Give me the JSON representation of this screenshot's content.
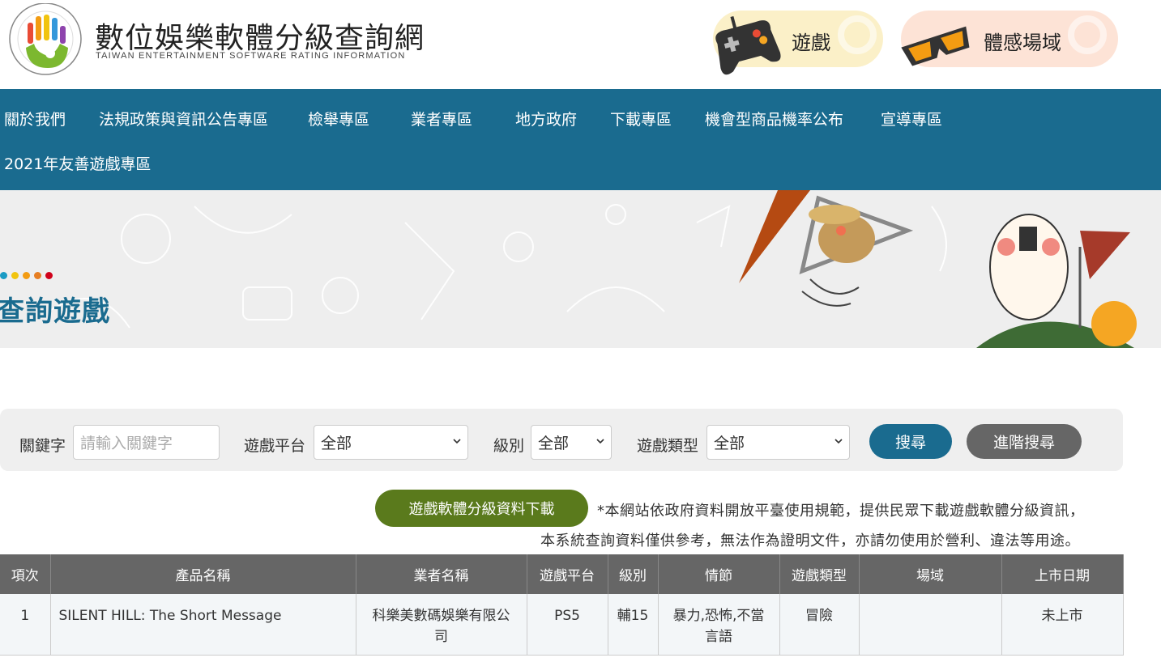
{
  "header": {
    "title": "數位娛樂軟體分級查詢網",
    "subtitle": "TAIWAN ENTERTAINMENT SOFTWARE RATING INFORMATION",
    "game_button": "遊戲",
    "vr_button": "體感場域"
  },
  "nav": {
    "items": [
      "關於我們",
      "法規政策與資訊公告專區",
      "檢舉專區",
      "業者專區",
      "地方政府",
      "下載專區",
      "機會型商品機率公布",
      "宣導專區",
      "2021年友善遊戲專區"
    ]
  },
  "banner": {
    "title": "查詢遊戲",
    "dot_colors": [
      "#1a9bc4",
      "#f1c40f",
      "#f39c12",
      "#e67e22",
      "#d0021b"
    ]
  },
  "search": {
    "keyword_label": "關鍵字",
    "keyword_placeholder": "請輸入關鍵字",
    "platform_label": "遊戲平台",
    "platform_value": "全部",
    "rating_label": "級別",
    "rating_value": "全部",
    "genre_label": "遊戲類型",
    "genre_value": "全部",
    "search_button": "搜尋",
    "advanced_button": "進階搜尋"
  },
  "download": {
    "button": "遊戲軟體分級資料下載",
    "notice_line1": "*本網站依政府資料開放平臺使用規範，提供民眾下載遊戲軟體分級資訊，",
    "notice_line2": "本系統查詢資料僅供參考，無法作為證明文件，亦請勿使用於營利、違法等用途。"
  },
  "table": {
    "headers": [
      "項次",
      "產品名稱",
      "業者名稱",
      "遊戲平台",
      "級別",
      "情節",
      "遊戲類型",
      "場域",
      "上市日期"
    ],
    "rows": [
      {
        "no": "1",
        "product": "SILENT HILL: The Short Message",
        "company_l1": "科樂美數碼娛樂有限公",
        "company_l2": "司",
        "platform": "PS5",
        "rating": "輔15",
        "content_l1": "暴力,恐怖,不當",
        "content_l2": "言語",
        "genre": "冒險",
        "venue": "",
        "release": "未上市"
      }
    ]
  },
  "colors": {
    "brand_blue": "#1a6b8f",
    "download_green": "#5a7a1c",
    "header_gray": "#666666"
  }
}
